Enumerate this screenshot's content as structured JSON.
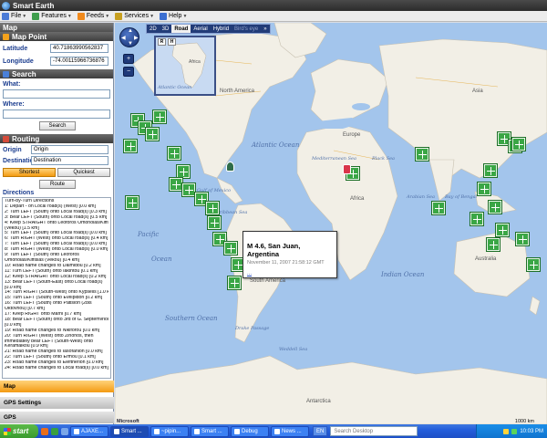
{
  "window": {
    "title": "Smart Earth"
  },
  "menu": [
    {
      "label": "File",
      "icon": "file-icon",
      "color": "#4b7bd6"
    },
    {
      "label": "Features",
      "icon": "features-icon",
      "color": "#3f9e4d"
    },
    {
      "label": "Feeds",
      "icon": "feeds-icon",
      "color": "#f08a1d"
    },
    {
      "label": "Services",
      "icon": "services-icon",
      "color": "#c8a020"
    },
    {
      "label": "Help",
      "icon": "help-icon",
      "color": "#3b6fd1"
    }
  ],
  "left": {
    "map_header": "Map",
    "map_point": {
      "header": "Map Point",
      "latitude_label": "Latitude",
      "latitude_value": "40.71863990562837",
      "longitude_label": "Longitude",
      "longitude_value": "-74.00115966736876"
    },
    "search": {
      "header": "Search",
      "what_label": "What:",
      "what_value": "",
      "where_label": "Where:",
      "where_value": "",
      "button": "Search"
    },
    "routing": {
      "header": "Routing",
      "origin_label": "Origin",
      "origin_value": "Origin",
      "destination_label": "Destination",
      "destination_value": "Destination",
      "shortest": "Shortest",
      "quickest": "Quickest",
      "route_button": "Route",
      "directions_label": "Directions",
      "directions": [
        "Turn-by-Turn Directions",
        "1: Depart - on Local road(s) (West) [0.0 km]",
        "2: Turn LEFT (South) onto Local road(s) [0.3 km]",
        "3: Bear LEFT (South) onto Local road(s) [0.5 km]",
        "4: Keep STRAIGHT onto Leoforos Omonoias/Kiffisias",
        "(Vekou) [1.5 km]",
        "5: Turn LEFT (South) onto Local road(s) [0.0 km]",
        "6: Turn RIGHT (West) onto Local road(s) [0.4 km]",
        "7: Turn LEFT (South) onto Local road(s) [0.0 km]",
        "8: Turn RIGHT (West) onto Local road(s) [0.0 km]",
        "9: Turn LEFT (South) onto Leoforos",
        "Omonoias/Kiffisias (Vekou) [0.4 km]",
        "10: Road name changes to Dalmidou [0.2 km]",
        "11: Turn LEFT (South) onto Iakintou [0.1 km]",
        "12: Keep STRAIGHT onto Local road(s) [0.2 km]",
        "13: Bear LEFT (South-East) onto Local road(s)",
        "[0.0 km]",
        "14: Turn RIGHT (South-West) onto Kypselis [1.0 km]",
        "15: Turn LEFT (South) onto Evelpidon [0.2 km]",
        "16: Turn LEFT (South) onto Patision (28is",
        "Oktovriou) [0.7 km]",
        "17: Keep RIGHT onto Marni [0.7 km]",
        "18: Bear LEFT (South) onto 3rd of G. Septemvriou",
        "[0.0 km]",
        "19: Road name changes to Nikiforou [0.0 km]",
        "20: Turn RIGHT (West) onto Zinonos, then",
        "immediately bear LEFT (South-West) onto",
        "Keramaikou [0.9 km]",
        "21: Road name changes to Iasofanion [0.0 km]",
        "22: Turn LEFT (South) onto Ermou [0.1 km]",
        "23: Road name changes to Eleftherion [0.0 km]",
        "24: Road name changes to Local road(s) [0.0 km]"
      ]
    },
    "bottom_tabs": [
      "Map",
      "GPS Settings",
      "GPS"
    ]
  },
  "map": {
    "view_tabs": [
      "2D",
      "3D",
      "Road",
      "Aerial",
      "Hybrid",
      "Bird's eye",
      "»"
    ],
    "active_view": "Road",
    "minimap_buttons": [
      "R",
      "H"
    ],
    "minimap_labels": [
      "Africa",
      "Atlantic Ocean"
    ],
    "ocean_labels": [
      "Pacific Ocean",
      "Atlantic Ocean",
      "Indian Ocean",
      "Southern Ocean",
      "Pacific",
      "Ocean"
    ],
    "land_labels": [
      "North America",
      "South America",
      "Europe",
      "Africa",
      "Asia",
      "Australia",
      "Antarctica",
      "Gulf of Mexico",
      "Mediterranean Sea",
      "Black Sea",
      "Arabian Sea",
      "Bay of Bengal",
      "Drake Passage",
      "Weddell Sea",
      "Caribbean Sea"
    ],
    "popup": {
      "title": "M 4.6, San Juan, Argentina",
      "date": "November 11, 2007 21:58:12 GMT",
      "link": "..."
    },
    "attribution": "Microsoft",
    "scale": "1000 km"
  },
  "taskbar": {
    "start": "start",
    "tasks": [
      "AJAXE...",
      "Smart ...",
      "~pipin...",
      "Smart ...",
      "Debug",
      "News ..."
    ],
    "active_task": "Smart ...",
    "language": "EN",
    "search_placeholder": "Search Desktop",
    "clock": "10:03 PM"
  },
  "colors": {
    "land": "#f2efe6",
    "ocean": "#a3c5ec",
    "quake_marker": "#3aa645",
    "accent_orange": "#f39a12"
  }
}
